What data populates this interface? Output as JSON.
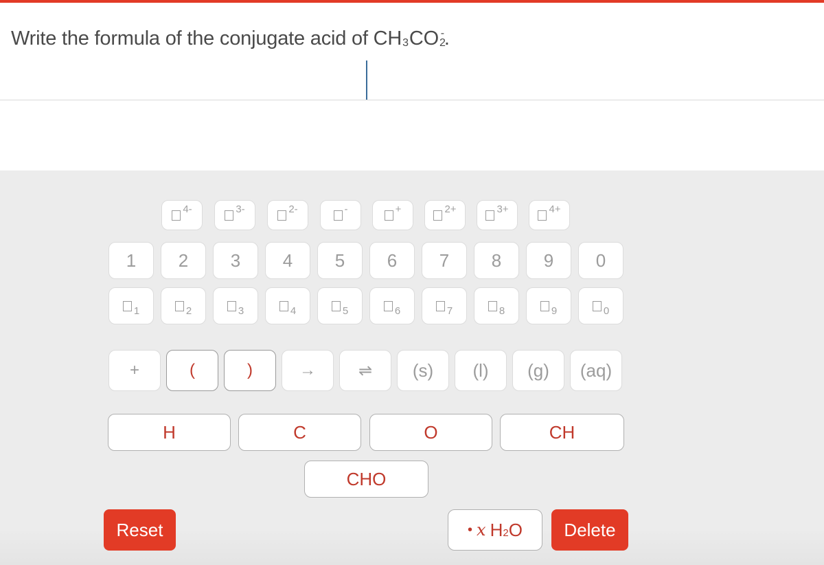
{
  "question": {
    "prefix": "Write the formula of the conjugate acid of ",
    "formula_parts": [
      "CH",
      "3",
      "CO",
      "2"
    ],
    "charge": "-",
    "suffix": "."
  },
  "palette": {
    "charge_keys": [
      {
        "sup": "4-"
      },
      {
        "sup": "3-"
      },
      {
        "sup": "2-"
      },
      {
        "sup": "-"
      },
      {
        "sup": "+"
      },
      {
        "sup": "2+"
      },
      {
        "sup": "3+"
      },
      {
        "sup": "4+"
      }
    ],
    "digit_keys": [
      "1",
      "2",
      "3",
      "4",
      "5",
      "6",
      "7",
      "8",
      "9",
      "0"
    ],
    "subscript_keys": [
      "1",
      "2",
      "3",
      "4",
      "5",
      "6",
      "7",
      "8",
      "9",
      "0"
    ],
    "symbol_keys": [
      "+",
      "(",
      ")",
      "→",
      "⇌",
      "(s)",
      "(l)",
      "(g)",
      "(aq)"
    ],
    "element_keys": [
      "H",
      "C",
      "O",
      "CH"
    ],
    "group_keys": [
      "CHO"
    ],
    "reset_label": "Reset",
    "hydrate": {
      "dot": "•",
      "x": "x",
      "h": "H",
      "sub": "2",
      "o": "O"
    },
    "delete_label": "Delete"
  },
  "colors": {
    "accent": "#e23b26",
    "element_text": "#c0392b",
    "key_text": "#9c9c9c",
    "palette_bg": "#ececec"
  }
}
